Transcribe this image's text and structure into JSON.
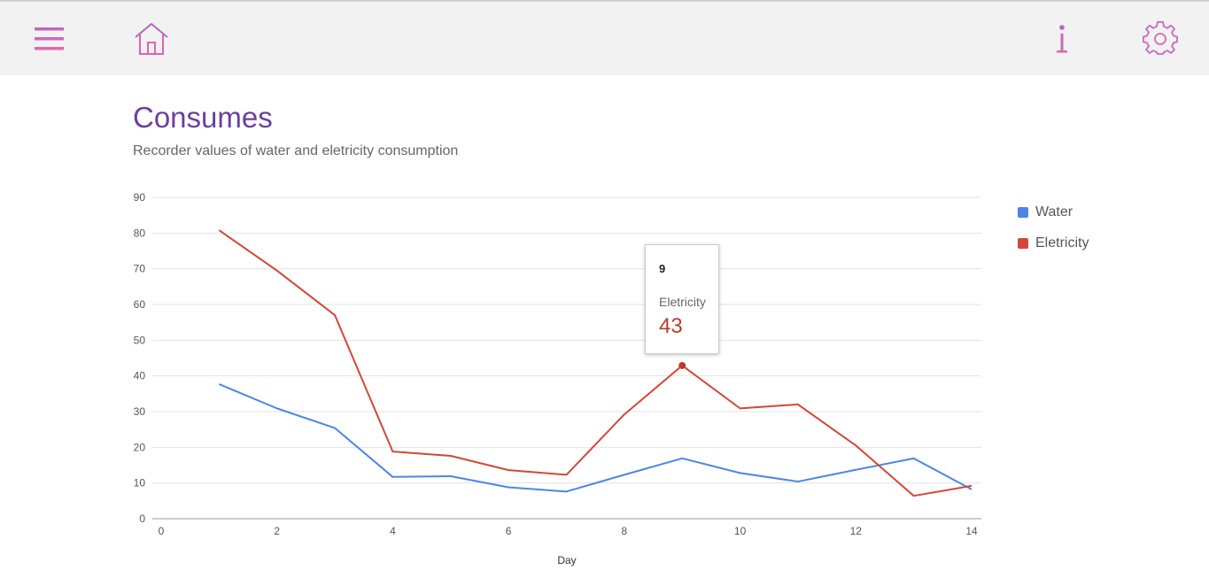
{
  "toolbar": {
    "menu_icon": "hamburger-menu-icon",
    "home_icon": "home-icon",
    "info_icon": "info-icon",
    "settings_icon": "gear-icon",
    "icon_color": "#d667b8"
  },
  "page": {
    "title": "Consumes",
    "subtitle": "Recorder values of water and eletricity consumption"
  },
  "chart_data": {
    "type": "line",
    "xlabel": "Day",
    "ylabel": "",
    "xlim": [
      0,
      14
    ],
    "ylim": [
      0,
      90
    ],
    "x_ticks": [
      0,
      2,
      4,
      6,
      8,
      10,
      12,
      14
    ],
    "y_ticks": [
      0,
      10,
      20,
      30,
      40,
      50,
      60,
      70,
      80,
      90
    ],
    "grid": true,
    "legend_position": "right",
    "x": [
      1,
      2,
      3,
      4,
      5,
      6,
      7,
      8,
      9,
      10,
      11,
      12,
      13,
      14
    ],
    "series": [
      {
        "name": "Water",
        "color": "#4a86e8",
        "values": [
          37.7,
          30.9,
          25.4,
          11.7,
          11.9,
          8.8,
          7.6,
          12.3,
          16.9,
          12.8,
          10.4,
          13.7,
          16.9,
          8.2
        ]
      },
      {
        "name": "Eletricity",
        "color": "#d44638",
        "values": [
          80.8,
          69.5,
          57.0,
          18.8,
          17.6,
          13.6,
          12.3,
          29.2,
          42.9,
          30.9,
          32.0,
          20.5,
          6.4,
          9.2
        ]
      }
    ],
    "tooltip": {
      "x": "9",
      "series": "Eletricity",
      "value": "43",
      "color": "#c0392b"
    }
  }
}
